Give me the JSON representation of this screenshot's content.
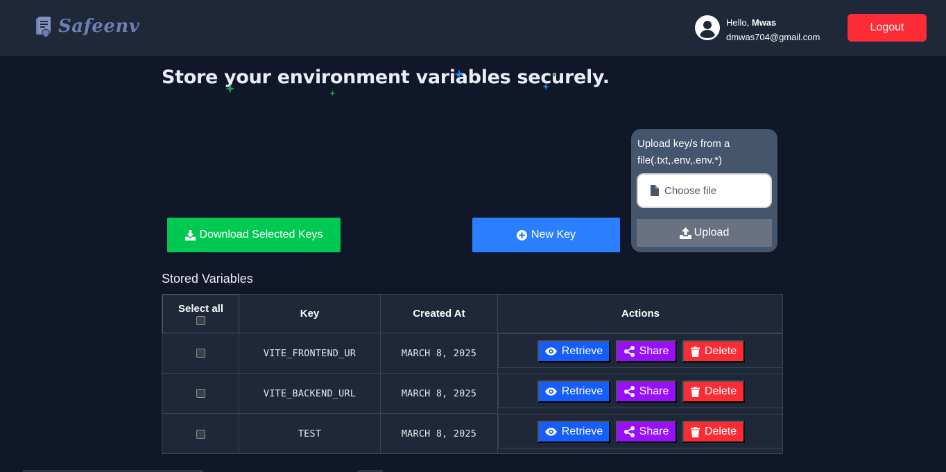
{
  "app": {
    "name": "Safeenv",
    "brand_color": "#6c7fb0"
  },
  "header": {
    "greeting_prefix": "Hello, ",
    "user_name": "Mwas",
    "user_email": "dmwas704@gmail.com",
    "logout_label": "Logout"
  },
  "hero": {
    "title": "Store your environment variables securely."
  },
  "toolbar": {
    "download_label": "Download Selected Keys",
    "new_key_label": "New Key"
  },
  "upload": {
    "title": "Upload key/s from a file(.txt,.env,.env.*)",
    "choose_file_label": "Choose file",
    "upload_label": "Upload"
  },
  "table": {
    "section_title": "Stored Variables",
    "headers": {
      "select_all": "Select all",
      "key": "Key",
      "created_at": "Created At",
      "actions": "Actions"
    },
    "rows": [
      {
        "key": "VITE_FRONTEND_UR",
        "created_at": "MARCH 8, 2025"
      },
      {
        "key": "VITE_BACKEND_URL",
        "created_at": "MARCH 8, 2025"
      },
      {
        "key": "TEST",
        "created_at": "MARCH 8, 2025"
      }
    ],
    "action_labels": {
      "retrieve": "Retrieve",
      "share": "Share",
      "delete": "Delete"
    }
  },
  "colors": {
    "background": "#101728",
    "header_bg": "#1e2838",
    "download_green": "#00c951",
    "new_key_blue": "#2b7fff",
    "retrieve_blue": "#155dfc",
    "share_purple": "#9810fa",
    "delete_red": "#fb2c36"
  }
}
